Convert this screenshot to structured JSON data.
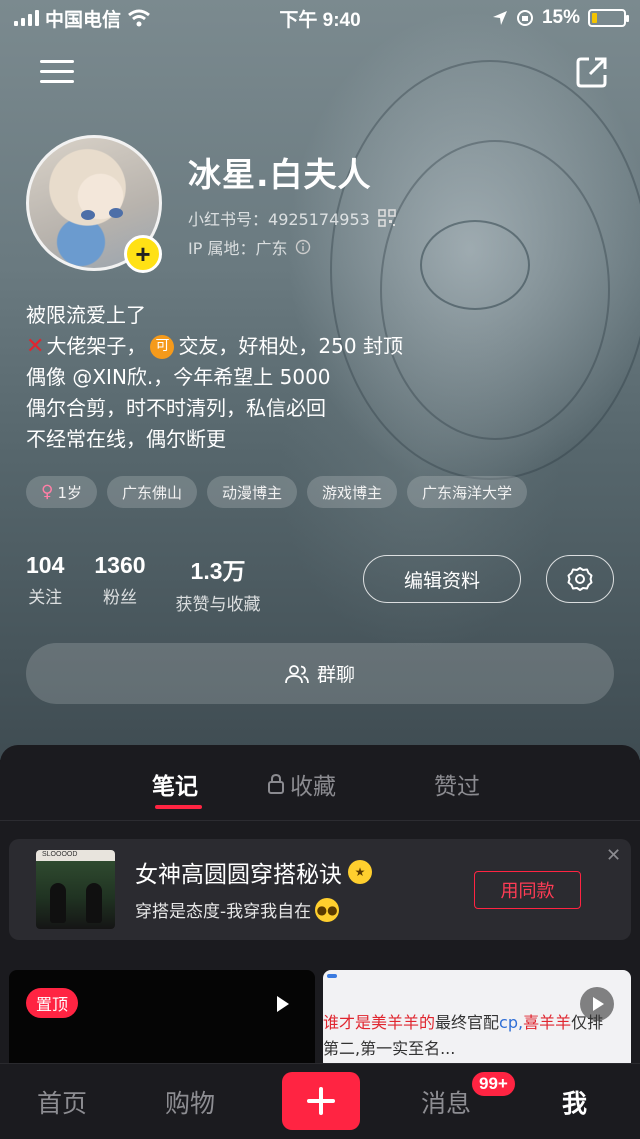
{
  "status_bar": {
    "carrier": "中国电信",
    "time": "下午 9:40",
    "battery_percent": "15%",
    "battery_level": 0.15,
    "icons": [
      "signal-icon",
      "wifi-icon",
      "location-icon",
      "orientation-lock-icon",
      "battery-icon"
    ]
  },
  "header": {
    "menu_icon": "menu-icon",
    "share_icon": "share-icon"
  },
  "profile": {
    "nickname": "冰星.白夫人",
    "id_label": "小红书号：",
    "id_value": "4925174953",
    "ip_label": "IP 属地：",
    "ip_value": "广东",
    "avatar_add": "+",
    "bio": {
      "line1": "被限流爱上了",
      "line2_a": "大佬架子，",
      "line2_coin": "可",
      "line2_b": "交友，好相处，250 封顶",
      "line3": "偶像 @XIN欣.，今年希望上 5000",
      "line4": "偶尔合剪，时不时清列，私信必回",
      "line5": "不经常在线，偶尔断更"
    },
    "tags": [
      {
        "label": "1岁",
        "icon": "female-icon"
      },
      {
        "label": "广东佛山"
      },
      {
        "label": "动漫博主"
      },
      {
        "label": "游戏博主"
      },
      {
        "label": "广东海洋大学"
      }
    ]
  },
  "stats": {
    "following_count": "104",
    "following_label": "关注",
    "followers_count": "1360",
    "followers_label": "粉丝",
    "likes_count": "1.3万",
    "likes_label": "获赞与收藏"
  },
  "actions": {
    "edit_profile": "编辑资料",
    "group_chat": "群聊"
  },
  "tabs": [
    {
      "label": "笔记",
      "active": true
    },
    {
      "label": "收藏",
      "active": false,
      "icon": "lock-icon"
    },
    {
      "label": "赞过",
      "active": false
    }
  ],
  "promo": {
    "title": "女神高圆圆穿搭秘诀",
    "subtitle": "穿搭是态度-我穿我自在",
    "use_button": "用同款",
    "thumb_caption": "SLOOOOD"
  },
  "notes": {
    "pinned_badge": "置顶",
    "right_line1_red_a": "谁才是美羊羊的",
    "right_line1_plain": "最终官配",
    "right_line1_blue": "cp,",
    "right_line1_red_b": "喜羊羊",
    "right_line1_tail": "仅排",
    "right_line2": "第二,第一实至名..."
  },
  "bottom_nav": {
    "home": "首页",
    "shop": "购物",
    "add": "+",
    "messages": "消息",
    "messages_badge": "99+",
    "me": "我"
  },
  "colors": {
    "accent": "#ff2442",
    "avatar_add": "#ffe115",
    "coin": "#f59a1b"
  }
}
